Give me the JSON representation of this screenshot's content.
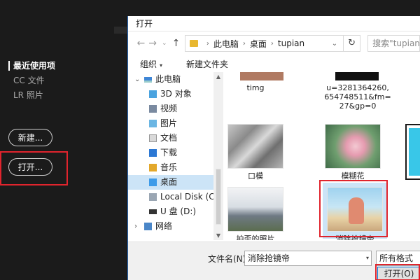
{
  "left_panel": {
    "nav": [
      {
        "label": "最近使用项",
        "active": true
      },
      {
        "label": "CC 文件",
        "active": false
      },
      {
        "label": "LR 照片",
        "active": false
      }
    ],
    "new_button": "新建...",
    "open_button": "打开..."
  },
  "dialog": {
    "title": "打开",
    "breadcrumb": [
      "此电脑",
      "桌面",
      "tupian"
    ],
    "search_placeholder": "搜索\"tupian",
    "toolbar": {
      "organize": "组织",
      "new_folder": "新建文件夹"
    },
    "tree": [
      {
        "label": "此电脑",
        "icon": "computer-icon",
        "level": 1,
        "expander": "v"
      },
      {
        "label": "3D 对象",
        "icon": "3d-objects-icon",
        "level": 2
      },
      {
        "label": "视频",
        "icon": "video-icon",
        "level": 2
      },
      {
        "label": "图片",
        "icon": "pictures-icon",
        "level": 2
      },
      {
        "label": "文档",
        "icon": "documents-icon",
        "level": 2
      },
      {
        "label": "下载",
        "icon": "download-icon",
        "level": 2
      },
      {
        "label": "音乐",
        "icon": "music-icon",
        "level": 2
      },
      {
        "label": "桌面",
        "icon": "desktop-icon",
        "level": 2,
        "selected": true
      },
      {
        "label": "Local Disk (C:)",
        "icon": "disk-icon",
        "level": 2
      },
      {
        "label": "U 盘 (D:)",
        "icon": "usb-drive-icon",
        "level": 2
      },
      {
        "label": "网络",
        "icon": "network-icon",
        "level": 1,
        "expander": ">"
      }
    ],
    "files": [
      {
        "label": "timg"
      },
      {
        "label": "u=3281364260,654748511&fm=27&gp=0"
      },
      {
        "label": "口模"
      },
      {
        "label": "模糊花"
      },
      {
        "label": "拍歪的照片"
      },
      {
        "label": "消除抢镜帝",
        "selected": true
      }
    ],
    "filename_label": "文件名(N):",
    "filename_value": "消除抢镜帝",
    "filetype": "所有格式",
    "open_button": "打开(O)"
  }
}
